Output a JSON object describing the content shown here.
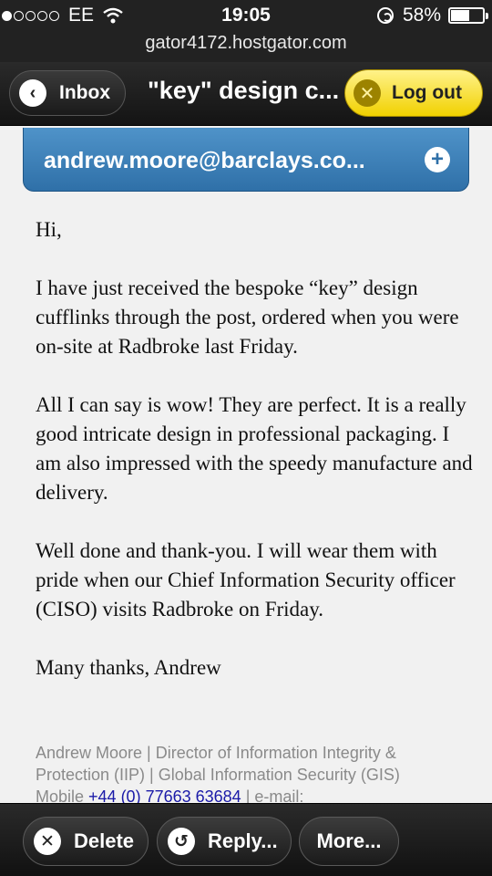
{
  "status_bar": {
    "carrier": "EE",
    "time": "19:05",
    "battery": "58%",
    "battery_level": 0.58,
    "url": "gator4172.hostgator.com"
  },
  "nav": {
    "back_label": "Inbox",
    "title": "\"key\" design c...",
    "logout_label": "Log out"
  },
  "sender": {
    "address": "andrew.moore@barclays.co..."
  },
  "body": {
    "greeting": "Hi,",
    "paragraph1": "I have just received the bespoke “key” design cufflinks through the post, ordered when you were on-site at Radbroke last Friday.",
    "paragraph2": "All I can say is wow!  They are perfect.  It is a really good intricate design in professional packaging.  I am also impressed with the speedy manufacture and delivery.",
    "paragraph3": "Well done and thank-you.  I will wear them with pride when our Chief Information Security officer (CISO) visits Radbroke on Friday.",
    "closing": "Many thanks, Andrew"
  },
  "signature": {
    "line1": "Andrew Moore | Director of Information Integrity & Protection (IIP) | Global Information Security (GIS)",
    "mobile_label": "Mobile ",
    "mobile_number": "+44 (0) 77663 63684",
    "email_label": " | e-mail:"
  },
  "toolbar": {
    "delete_label": "Delete",
    "reply_label": "Reply...",
    "more_label": "More..."
  },
  "icons": {
    "back": "chevron-left-icon",
    "logout": "close-icon",
    "add": "plus-icon",
    "delete": "close-icon",
    "reply": "reply-arrow-icon"
  },
  "colors": {
    "logout_button": "#f1d100",
    "sender_bar": "#2f70a8",
    "link": "#1a1aa8"
  }
}
